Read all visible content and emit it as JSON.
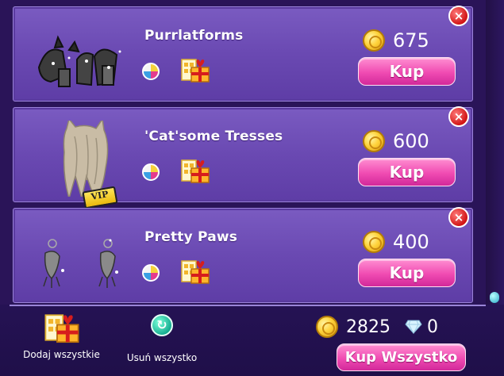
{
  "items": [
    {
      "name": "Purrlatforms",
      "price": "675",
      "buy_label": "Kup",
      "remove_label": "×",
      "vip_label": ""
    },
    {
      "name": "'Cat'some Tresses",
      "price": "600",
      "buy_label": "Kup",
      "remove_label": "×",
      "vip_label": "VIP"
    },
    {
      "name": "Pretty Paws",
      "price": "400",
      "buy_label": "Kup",
      "remove_label": "×",
      "vip_label": ""
    }
  ],
  "footer": {
    "add_all_label": "Dodaj wszystkie",
    "remove_all_label": "Usuń wszystko",
    "total_coins": "2825",
    "total_diamonds": "0",
    "buy_all_label": "Kup Wszystko",
    "reset_icon_glyph": "↻"
  },
  "colors": {
    "panel": "#6a49b2",
    "buy_button": "#f04bb2",
    "coin": "#ffd23a",
    "close": "#d11414"
  },
  "icons": [
    "coin-icon",
    "color-wheel-icon",
    "gift-icon",
    "close-icon",
    "reset-icon",
    "diamond-icon",
    "scroll-thumb"
  ]
}
